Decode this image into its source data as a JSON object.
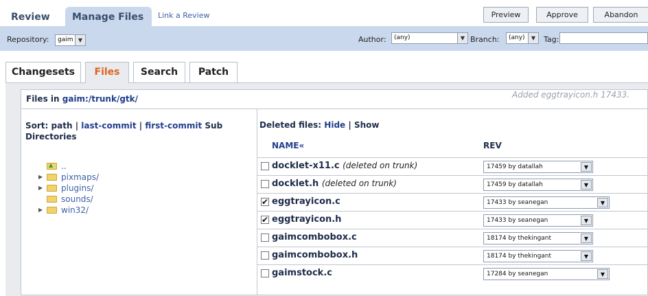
{
  "top_tabs": {
    "review": "Review",
    "manage_files": "Manage Files",
    "link_review": "Link a Review"
  },
  "actions": {
    "preview": "Preview",
    "approve": "Approve",
    "abandon": "Abandon"
  },
  "filters": {
    "repository_label": "Repository:",
    "repository_value": "gaim",
    "author_label": "Author:",
    "author_value": "(any)",
    "branch_label": "Branch:",
    "branch_value": "(any)",
    "tag_label": "Tag:"
  },
  "sub_tabs": [
    "Changesets",
    "Files",
    "Search",
    "Patch"
  ],
  "files_in": {
    "prefix": "Files in",
    "path": "gaim:/trunk/gtk/"
  },
  "added_note": "Added eggtrayicon.h 17433.",
  "sort": {
    "label": "Sort:",
    "path": "path",
    "sep": "|",
    "last_commit": "last-commit",
    "first_commit": "first-commit",
    "subdirs": "Sub Directories"
  },
  "tree": [
    {
      "name": "..",
      "expandable": false,
      "icon": "folder-up-icon"
    },
    {
      "name": "pixmaps/",
      "expandable": true,
      "icon": "folder-icon"
    },
    {
      "name": "plugins/",
      "expandable": true,
      "icon": "folder-icon"
    },
    {
      "name": "sounds/",
      "expandable": false,
      "icon": "folder-icon"
    },
    {
      "name": "win32/",
      "expandable": true,
      "icon": "folder-icon"
    }
  ],
  "deleted_files": {
    "label": "Deleted files:",
    "hide": "Hide",
    "sep": "|",
    "show": "Show"
  },
  "columns": {
    "name": "NAME«",
    "rev": "REV"
  },
  "files": [
    {
      "name": "docklet-x11.c",
      "note": "(deleted on trunk)",
      "checked": false,
      "rev": "17459 by datallah"
    },
    {
      "name": "docklet.h",
      "note": "(deleted on trunk)",
      "checked": false,
      "rev": "17459 by datallah"
    },
    {
      "name": "eggtrayicon.c",
      "note": "",
      "checked": true,
      "rev": "17433 by seanegan"
    },
    {
      "name": "eggtrayicon.h",
      "note": "",
      "checked": true,
      "rev": "17433 by seanegan"
    },
    {
      "name": "gaimcombobox.c",
      "note": "",
      "checked": false,
      "rev": "18174 by thekingant"
    },
    {
      "name": "gaimcombobox.h",
      "note": "",
      "checked": false,
      "rev": "18174 by thekingant"
    },
    {
      "name": "gaimstock.c",
      "note": "",
      "checked": false,
      "rev": "17284 by seanegan"
    }
  ],
  "colors": {
    "accent": "#c9d8ec",
    "active_tab": "#e0641d",
    "link": "#1f3e8c"
  }
}
